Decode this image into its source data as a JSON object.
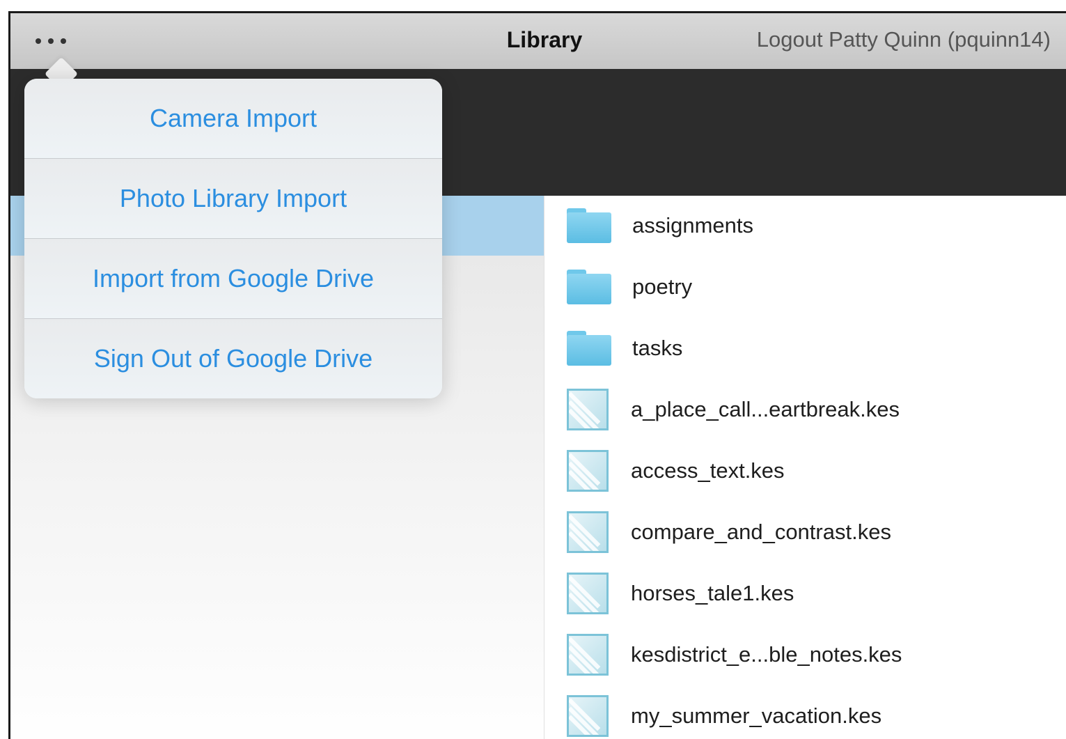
{
  "navbar": {
    "title": "Library",
    "logout_label": "Logout Patty Quinn (pquinn14)",
    "more_icon": "ellipsis-icon"
  },
  "popover_menu": {
    "items": [
      {
        "label": "Camera Import"
      },
      {
        "label": "Photo Library Import"
      },
      {
        "label": "Import from Google Drive"
      },
      {
        "label": "Sign Out of Google Drive"
      }
    ],
    "text_color": "#2b8ee0"
  },
  "files": [
    {
      "name": "assignments",
      "type": "folder"
    },
    {
      "name": "poetry",
      "type": "folder"
    },
    {
      "name": "tasks",
      "type": "folder"
    },
    {
      "name": "a_place_call...eartbreak.kes",
      "type": "document"
    },
    {
      "name": "access_text.kes",
      "type": "document"
    },
    {
      "name": "compare_and_contrast.kes",
      "type": "document"
    },
    {
      "name": "horses_tale1.kes",
      "type": "document"
    },
    {
      "name": "kesdistrict_e...ble_notes.kes",
      "type": "document"
    },
    {
      "name": "my_summer_vacation.kes",
      "type": "document"
    }
  ],
  "colors": {
    "selection": "#a8d1ec",
    "header_band": "#2c2c2c",
    "folder": "#6fc8ea"
  }
}
